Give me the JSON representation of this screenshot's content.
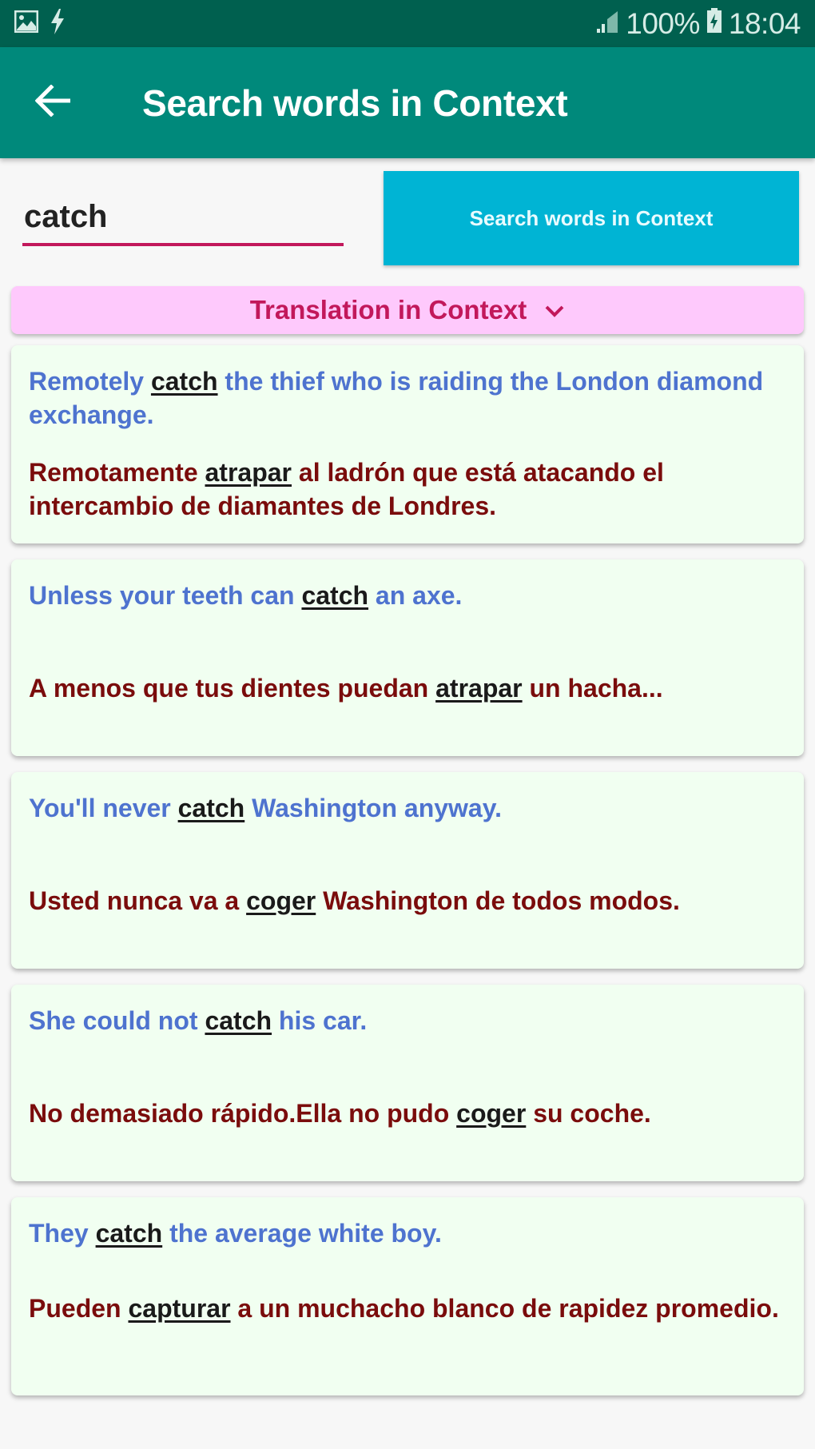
{
  "status_bar": {
    "left_icons": [
      "image-notification-icon",
      "flash-icon"
    ],
    "signal_icon": "signal-bars-icon",
    "battery_percent": "100%",
    "battery_icon": "battery-charging-icon",
    "time": "18:04"
  },
  "app_bar": {
    "back_icon": "arrow-back-icon",
    "title": "Search words in Context"
  },
  "search": {
    "value": "catch",
    "button_label": "Search words in Context"
  },
  "translation_toggle": {
    "label": "Translation in Context",
    "icon": "chevron-down-icon"
  },
  "colors": {
    "status_bar": "#00604f",
    "app_bar": "#00897b",
    "search_button": "#00b4d4",
    "accent": "#c2185b",
    "toggle_bg": "#fec9fc",
    "card_bg": "#f1fff1",
    "english_text": "#4e73cf",
    "spanish_text": "#7a0c0c"
  },
  "results": [
    {
      "en": {
        "before": "Remotely ",
        "keyword": "catch",
        "after": " the thief who is raiding the London diamond exchange."
      },
      "es": {
        "before": "Remotamente ",
        "keyword": "atrapar",
        "after": " al ladrón que está atacando el intercambio de diamantes de Londres."
      }
    },
    {
      "en": {
        "before": "Unless your teeth can ",
        "keyword": "catch",
        "after": " an axe."
      },
      "es": {
        "before": "A menos que tus dientes puedan ",
        "keyword": "atrapar",
        "after": " un hacha..."
      }
    },
    {
      "en": {
        "before": "You'll never ",
        "keyword": "catch",
        "after": " Washington anyway."
      },
      "es": {
        "before": "Usted nunca va a ",
        "keyword": "coger",
        "after": " Washington de todos modos."
      }
    },
    {
      "en": {
        "before": "She could not ",
        "keyword": "catch",
        "after": " his car."
      },
      "es": {
        "before": "No demasiado rápido.Ella no pudo ",
        "keyword": "coger",
        "after": " su coche."
      }
    },
    {
      "en": {
        "before": "They ",
        "keyword": "catch",
        "after": " the average white boy."
      },
      "es": {
        "before": "Pueden ",
        "keyword": "capturar",
        "after": " a un muchacho blanco de rapidez promedio."
      }
    }
  ]
}
